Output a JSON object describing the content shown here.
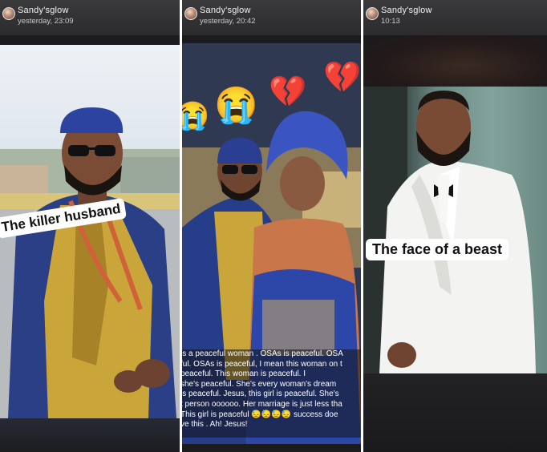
{
  "stories": [
    {
      "username": "Sandy'sglow",
      "timestamp": "yesterday, 23:09",
      "caption": "The killer husband"
    },
    {
      "username": "Sandy'sglow",
      "timestamp": "yesterday, 20:42",
      "stickers": [
        "😭",
        "😭",
        "💔",
        "💔"
      ],
      "text_lines": [
        "is a peaceful woman . OSAs is peaceful. OSA",
        "ful. OSAs is peaceful, I mean this woman on t",
        "peaceful. This woman is peaceful. I",
        "she's peaceful.  She's every woman's dream",
        "is peaceful. Jesus, this girl is peaceful. She's",
        "t person oooooo. Her marriage is just less tha",
        "This girl is peaceful 😓😓😓😓 success doe",
        "ve this . Ah! Jesus!"
      ]
    },
    {
      "username": "Sandy'sglow",
      "timestamp": "10:13",
      "caption": "The face of a beast"
    }
  ]
}
